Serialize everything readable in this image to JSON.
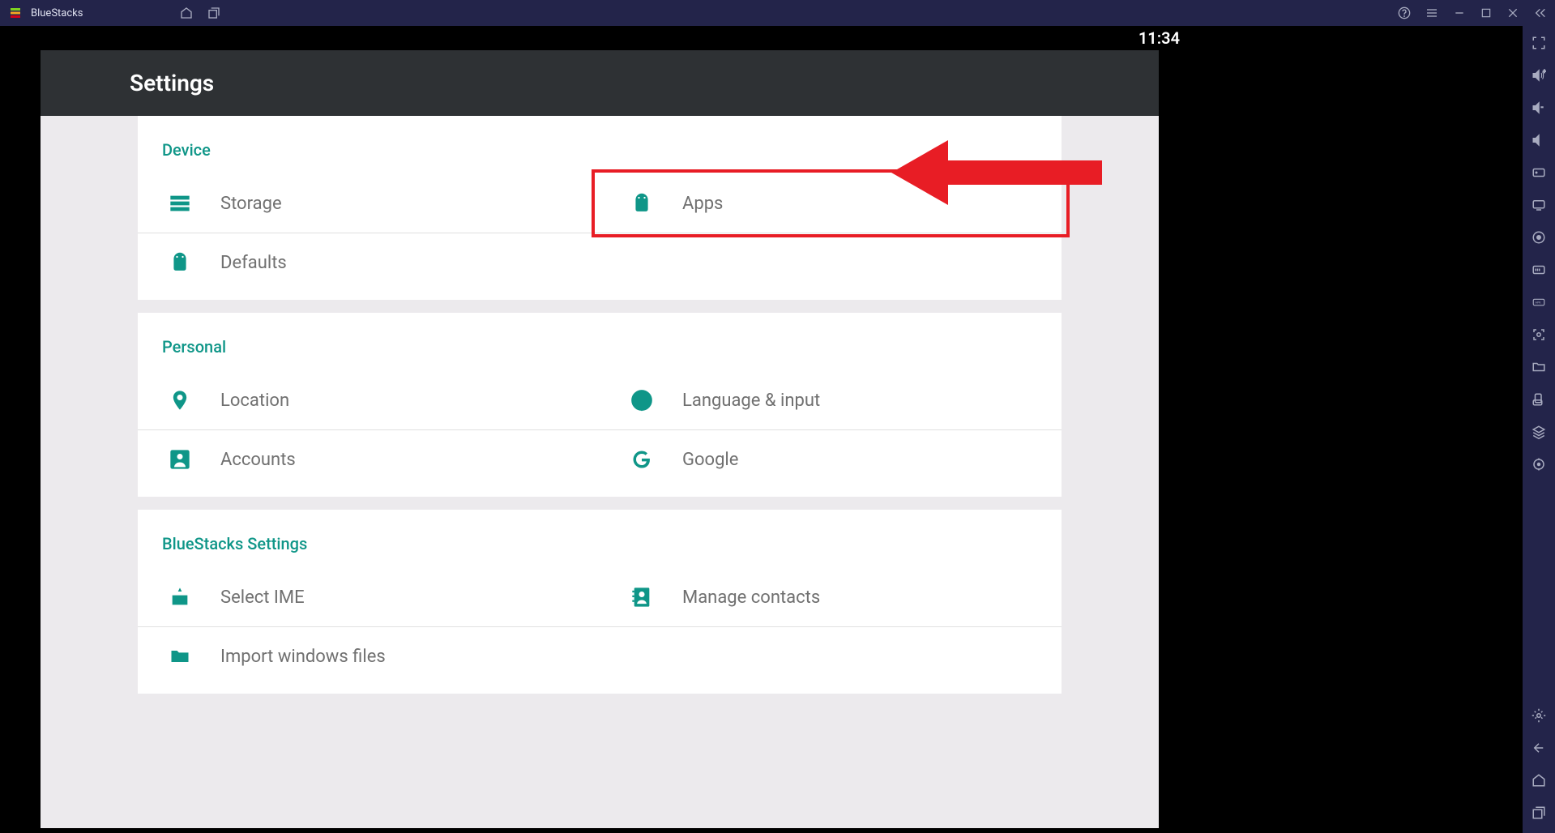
{
  "app": {
    "title": "BlueStacks"
  },
  "statusbar": {
    "time": "11:34"
  },
  "settings": {
    "header": "Settings",
    "sections": [
      {
        "title": "Device",
        "items": {
          "storage": "Storage",
          "apps": "Apps",
          "defaults": "Defaults"
        }
      },
      {
        "title": "Personal",
        "items": {
          "location": "Location",
          "language": "Language & input",
          "accounts": "Accounts",
          "google": "Google"
        }
      },
      {
        "title": "BlueStacks Settings",
        "items": {
          "ime": "Select IME",
          "contacts": "Manage contacts",
          "import": "Import windows files"
        }
      }
    ]
  },
  "annotation": {
    "highlight_target": "Apps",
    "arrow_color": "#e81d25"
  }
}
